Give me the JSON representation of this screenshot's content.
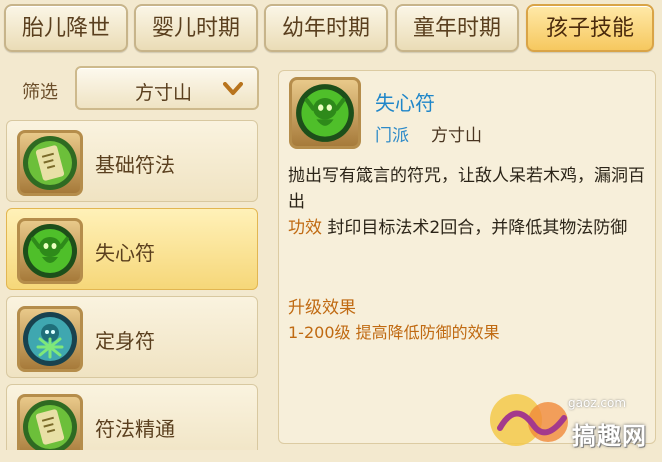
{
  "tabs": [
    {
      "label": "胎儿降世",
      "active": false
    },
    {
      "label": "婴儿时期",
      "active": false
    },
    {
      "label": "幼年时期",
      "active": false
    },
    {
      "label": "童年时期",
      "active": false
    },
    {
      "label": "孩子技能",
      "active": true
    }
  ],
  "filter": {
    "label": "筛选",
    "value": "方寸山",
    "icon": "chevron-down-icon"
  },
  "skills": [
    {
      "name": "基础符法",
      "icon": "talisman-icon",
      "selected": false
    },
    {
      "name": "失心符",
      "icon": "green-spirit-icon",
      "selected": true
    },
    {
      "name": "定身符",
      "icon": "blue-spirit-icon",
      "selected": false
    },
    {
      "name": "符法精通",
      "icon": "talisman-icon",
      "selected": false
    }
  ],
  "detail": {
    "title": "失心符",
    "icon": "green-spirit-icon",
    "school_label": "门派",
    "school_value": "方寸山",
    "description": "抛出写有箴言的符咒，让敌人呆若木鸡，漏洞百出",
    "effect_label": "功效",
    "effect_text": "封印目标法术2回合，并降低其物法防御",
    "upgrade_title": "升级效果",
    "upgrade_text": "1-200级 提高降低防御的效果"
  },
  "watermark": {
    "url": "gaoz.com",
    "text": "搞趣网"
  },
  "colors": {
    "background": "#f3e9cf",
    "tab_active": "#f6c85f",
    "title_blue": "#1f86c9",
    "effect_orange": "#c06a12"
  }
}
